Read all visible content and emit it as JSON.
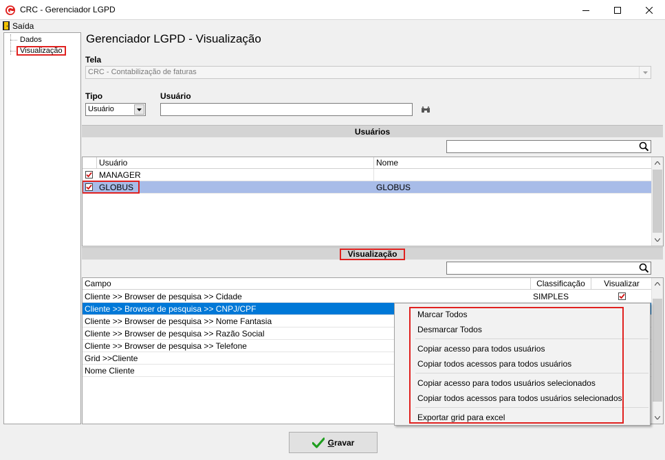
{
  "window": {
    "title": "CRC - Gerenciador LGPD"
  },
  "menu": {
    "saida": "Saída"
  },
  "tree": {
    "items": [
      "Dados",
      "Visualização"
    ]
  },
  "page": {
    "title": "Gerenciador LGPD - Visualização"
  },
  "form": {
    "tela_label": "Tela",
    "tela_value": "CRC - Contabilização de faturas",
    "tipo_label": "Tipo",
    "tipo_value": "Usuário",
    "usuario_label": "Usuário",
    "usuario_value": ""
  },
  "usuarios": {
    "section_title": "Usuários",
    "search_value": "",
    "columns": [
      "Usuário",
      "Nome"
    ],
    "rows": [
      {
        "usuario": "MANAGER",
        "nome": "",
        "checked": true
      },
      {
        "usuario": "GLOBUS",
        "nome": "GLOBUS",
        "checked": true
      }
    ]
  },
  "visualizacao": {
    "section_title": "Visualização",
    "search_value": "",
    "columns": [
      "Campo",
      "Classificação",
      "Visualizar"
    ],
    "rows": [
      {
        "campo": "Cliente >> Browser de pesquisa >> Cidade",
        "classificacao": "SIMPLES",
        "visualizar": true
      },
      {
        "campo": "Cliente >> Browser de pesquisa >> CNPJ/CPF",
        "classificacao": "",
        "visualizar": false
      },
      {
        "campo": "Cliente >> Browser de pesquisa >> Nome Fantasia",
        "classificacao": "",
        "visualizar": false
      },
      {
        "campo": "Cliente >> Browser de pesquisa >> Razão Social",
        "classificacao": "",
        "visualizar": false
      },
      {
        "campo": "Cliente >> Browser de pesquisa >> Telefone",
        "classificacao": "",
        "visualizar": false
      },
      {
        "campo": "Grid >>Cliente",
        "classificacao": "",
        "visualizar": false
      },
      {
        "campo": "Nome Cliente",
        "classificacao": "",
        "visualizar": false
      }
    ]
  },
  "context_menu": {
    "items": [
      "Marcar Todos",
      "Desmarcar Todos",
      "Copiar acesso para todos usuários",
      "Copiar todos acessos para todos usuários",
      "Copiar acesso para todos usuários selecionados",
      "Copiar todos acessos para todos usuários selecionados",
      "Exportar grid para excel"
    ]
  },
  "buttons": {
    "gravar_first": "G",
    "gravar_rest": "ravar"
  },
  "colors": {
    "selection": "#a8bce8",
    "selection_focus": "#0078d7",
    "highlight_red": "#e0201e"
  }
}
